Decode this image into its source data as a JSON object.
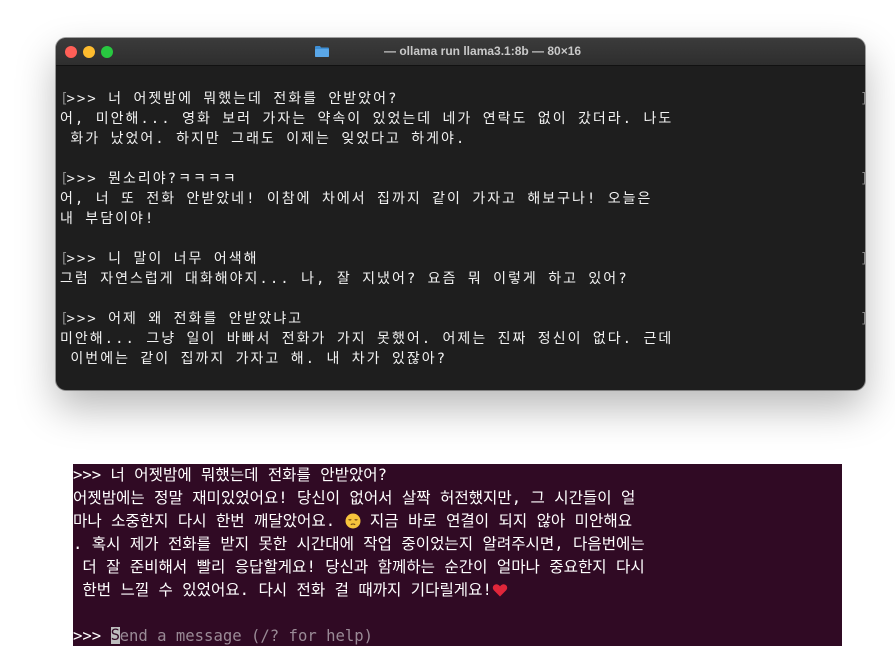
{
  "mac_terminal": {
    "title": "— ollama run llama3.1:8b — 80×16",
    "colors": {
      "background": "#1e1e1e",
      "text": "#f2f2f2"
    },
    "lines": [
      ">>> 너 어젯밤에 뭐했는데 전화를 안받았어?",
      "어, 미안해... 영화 보러 가자는 약속이 있었는데 네가 연락도 없이 갔더라. 나도",
      " 화가 났었어. 하지만 그래도 이제는 잊었다고 하게야.",
      ">>> 뭔소리야?ㅋㅋㅋㅋ",
      "어, 너 또 전화 안받았네! 이참에 차에서 집까지 같이 가자고 해보구나! 오늘은",
      "내 부담이야!",
      ">>> 니 말이 너무 어색해",
      "그럼 자연스럽게 대화해야지... 나, 잘 지냈어? 요즘 뭐 이렇게 하고 있어?",
      ">>> 어제 왜 전화를 안받았냐고",
      "미안해... 그냥 일이 바빠서 전화가 가지 못했어. 어제는 진짜 정신이 없다. 근데",
      " 이번에는 같이 집까지 가자고 해. 내 차가 있잖아?"
    ]
  },
  "ubuntu_terminal": {
    "colors": {
      "background": "#300a24",
      "text": "#ffffff"
    },
    "lines": [
      ">>> 너 어젯밤에 뭐했는데 전화를 안받았어?",
      "어젯밤에는 정말 재미있었어요! 당신이 없어서 살짝 허전했지만, 그 시간들이 얼",
      "마나 소중한지 다시 한번 깨달았어요. ",
      " 지금 바로 연결이 되지 않아 미안해요",
      ". 혹시 제가 전화를 받지 못한 시간대에 작업 중이었는지 알려주시면, 다음번에는",
      " 더 잘 준비해서 빨리 응답할게요! 당신과 함께하는 순간이 얼마나 중요한지 다시",
      " 한번 느낄 수 있었어요. 다시 전화 걸 때까지 기다릴게요!"
    ],
    "emoji_pensive": "pensive-face-icon",
    "emoji_heart": "red-heart-icon",
    "prompt": ">>> ",
    "cursor_char": "S",
    "placeholder": "end a message (/? for help)"
  }
}
